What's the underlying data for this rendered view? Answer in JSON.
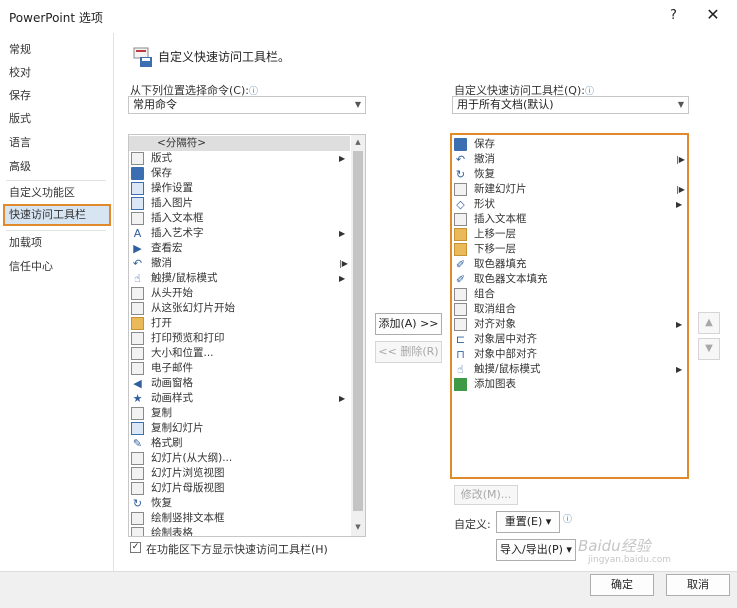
{
  "window": {
    "title": "PowerPoint 选项",
    "help": "?",
    "close": "✕"
  },
  "sidebar": {
    "items": [
      {
        "label": "常规"
      },
      {
        "label": "校对"
      },
      {
        "label": "保存"
      },
      {
        "label": "版式"
      },
      {
        "label": "语言"
      },
      {
        "label": "高级"
      },
      {
        "label": "自定义功能区"
      },
      {
        "label": "快速访问工具栏"
      },
      {
        "label": "加载项"
      },
      {
        "label": "信任中心"
      }
    ]
  },
  "header": {
    "title": "自定义快速访问工具栏。"
  },
  "left_panel": {
    "label": "从下列位置选择命令(C):",
    "info": "ⓘ",
    "combo_value": "常用命令",
    "commands": [
      {
        "label": "<分隔符>",
        "icon": "separator"
      },
      {
        "label": "版式",
        "icon": "layout-icon"
      },
      {
        "label": "保存",
        "icon": "save-icon"
      },
      {
        "label": "操作设置",
        "icon": "action-icon"
      },
      {
        "label": "插入图片",
        "icon": "picture-icon"
      },
      {
        "label": "插入文本框",
        "icon": "textbox-icon"
      },
      {
        "label": "插入艺术字",
        "icon": "wordart-icon"
      },
      {
        "label": "查看宏",
        "icon": "macro-icon"
      },
      {
        "label": "撤消",
        "icon": "undo-icon"
      },
      {
        "label": "触摸/鼠标模式",
        "icon": "touch-icon"
      },
      {
        "label": "从头开始",
        "icon": "slideshow-icon"
      },
      {
        "label": "从这张幻灯片开始",
        "icon": "slideshow-current-icon"
      },
      {
        "label": "打开",
        "icon": "open-icon"
      },
      {
        "label": "打印预览和打印",
        "icon": "print-icon"
      },
      {
        "label": "大小和位置...",
        "icon": "size-icon"
      },
      {
        "label": "电子邮件",
        "icon": "email-icon"
      },
      {
        "label": "动画窗格",
        "icon": "animation-pane-icon"
      },
      {
        "label": "动画样式",
        "icon": "animation-star-icon"
      },
      {
        "label": "复制",
        "icon": "copy-icon"
      },
      {
        "label": "复制幻灯片",
        "icon": "duplicate-slide-icon"
      },
      {
        "label": "格式刷",
        "icon": "format-painter-icon"
      },
      {
        "label": "幻灯片(从大纲)...",
        "icon": "outline-icon"
      },
      {
        "label": "幻灯片浏览视图",
        "icon": "sorter-icon"
      },
      {
        "label": "幻灯片母版视图",
        "icon": "master-icon"
      },
      {
        "label": "恢复",
        "icon": "redo-icon"
      },
      {
        "label": "绘制竖排文本框",
        "icon": "vertical-textbox-icon"
      },
      {
        "label": "绘制表格",
        "icon": "table-icon"
      }
    ]
  },
  "right_panel": {
    "label": "自定义快速访问工具栏(Q):",
    "info": "ⓘ",
    "combo_value": "用于所有文档(默认)",
    "commands": [
      {
        "label": "保存",
        "icon": "save-icon"
      },
      {
        "label": "撤消",
        "icon": "undo-icon"
      },
      {
        "label": "恢复",
        "icon": "redo-icon"
      },
      {
        "label": "新建幻灯片",
        "icon": "new-slide-icon"
      },
      {
        "label": "形状",
        "icon": "shapes-icon"
      },
      {
        "label": "插入文本框",
        "icon": "textbox-icon"
      },
      {
        "label": "上移一层",
        "icon": "bring-forward-icon"
      },
      {
        "label": "下移一层",
        "icon": "send-backward-icon"
      },
      {
        "label": "取色器填充",
        "icon": "eyedropper-icon"
      },
      {
        "label": "取色器文本填充",
        "icon": "eyedropper-text-icon"
      },
      {
        "label": "组合",
        "icon": "group-icon"
      },
      {
        "label": "取消组合",
        "icon": "ungroup-icon"
      },
      {
        "label": "对齐对象",
        "icon": "align-icon"
      },
      {
        "label": "对象居中对齐",
        "icon": "align-center-icon"
      },
      {
        "label": "对象中部对齐",
        "icon": "align-middle-icon"
      },
      {
        "label": "触摸/鼠标模式",
        "icon": "touch-icon"
      },
      {
        "label": "添加图表",
        "icon": "chart-icon"
      }
    ]
  },
  "buttons": {
    "add": "添加(A) >>",
    "remove": "<< 删除(R)",
    "modify": "修改(M)...",
    "customize_label": "自定义:",
    "reset": "重置(E) ▾",
    "import_export": "导入/导出(P) ▾",
    "ok": "确定",
    "cancel": "取消",
    "move_up": "▲",
    "move_down": "▼"
  },
  "checkbox": {
    "label": "在功能区下方显示快速访问工具栏(H)",
    "checked": true,
    "mark": "✓"
  },
  "watermark": {
    "text": "Baidu经验",
    "url": "jingyan.baidu.com"
  },
  "accent": "#e08a2c"
}
